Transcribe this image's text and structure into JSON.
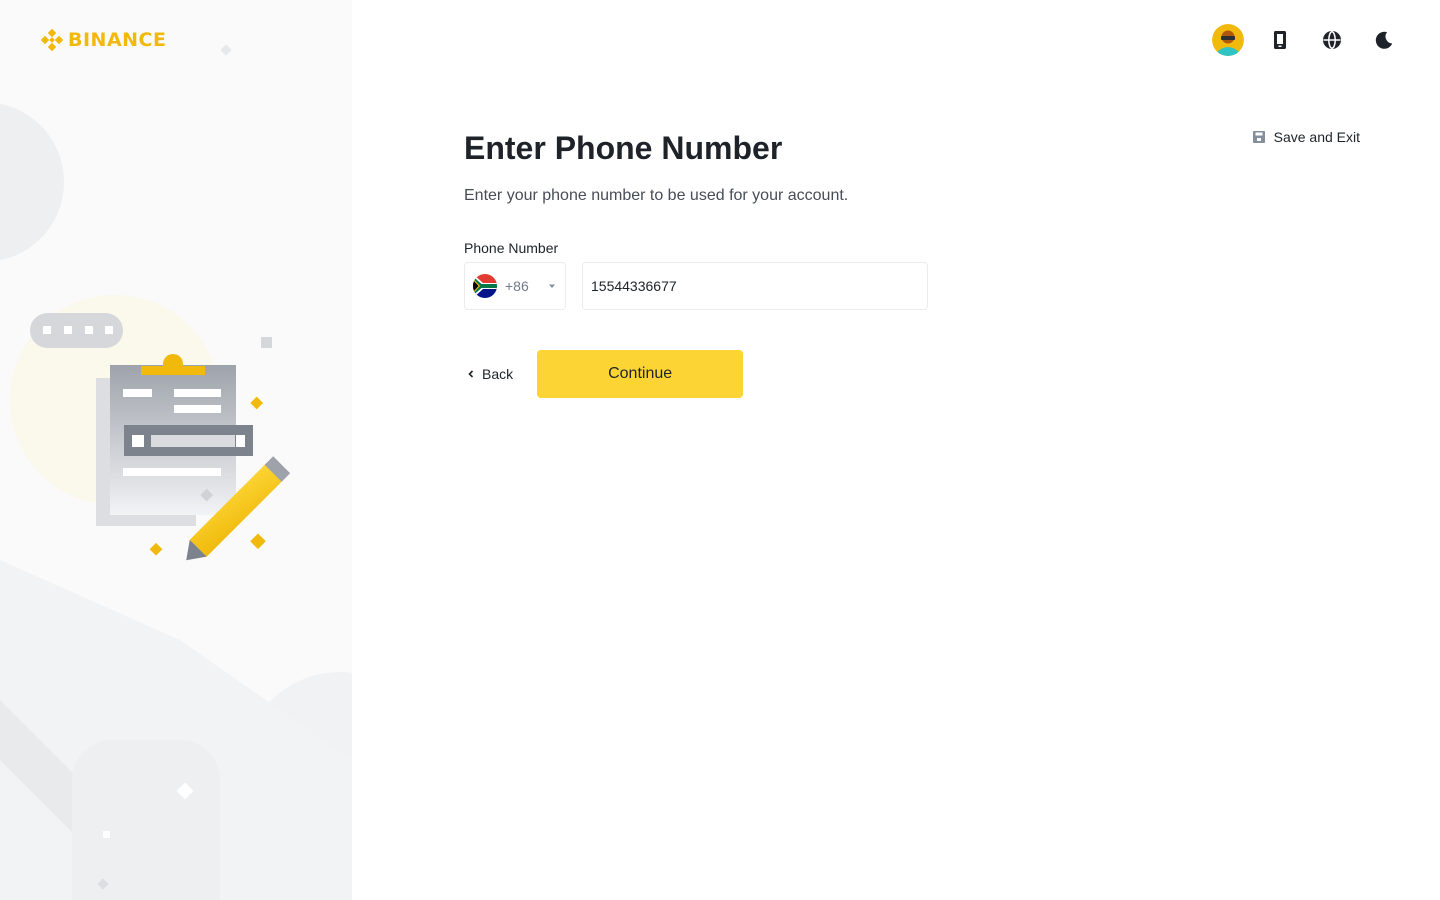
{
  "brand": {
    "name": "BINANCE",
    "accent_color": "#F0B90B",
    "button_color": "#FCD535"
  },
  "header": {
    "icons": [
      "avatar",
      "mobile-download-icon",
      "globe-icon",
      "moon-icon"
    ]
  },
  "save_exit": {
    "label": "Save and Exit",
    "icon": "save-icon"
  },
  "form": {
    "title": "Enter Phone Number",
    "subtitle": "Enter your phone number to be used for your account.",
    "phone_label": "Phone Number",
    "country_code": "+86",
    "country_flag": "south-africa-flag-icon",
    "phone_value": "15544336677",
    "back_label": "Back",
    "continue_label": "Continue"
  }
}
